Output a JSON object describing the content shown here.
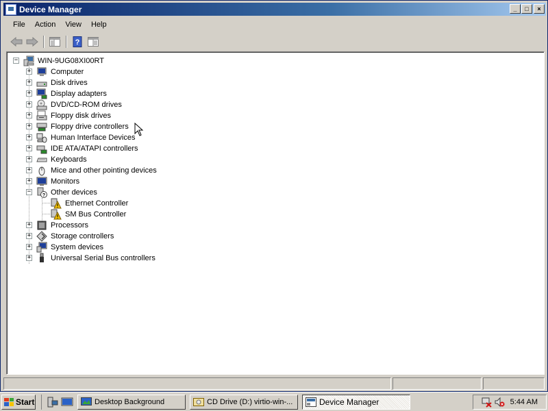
{
  "window": {
    "title": "Device Manager",
    "buttons": {
      "minimize": "_",
      "maximize": "□",
      "close": "×"
    }
  },
  "menu": [
    "File",
    "Action",
    "View",
    "Help"
  ],
  "toolbar": {
    "icons": [
      "back-arrow-icon",
      "forward-arrow-icon",
      "show-hide-console-tree-icon",
      "help-icon",
      "properties-icon"
    ]
  },
  "tree": {
    "root": {
      "label": "WIN-9UG08XI00RT",
      "icon": "computer-icon",
      "expanded": true
    },
    "categories": [
      {
        "label": "Computer",
        "icon": "computer-icon",
        "expanded": false
      },
      {
        "label": "Disk drives",
        "icon": "disk-drive-icon",
        "expanded": false
      },
      {
        "label": "Display adapters",
        "icon": "display-adapter-icon",
        "expanded": false
      },
      {
        "label": "DVD/CD-ROM drives",
        "icon": "dvd-drive-icon",
        "expanded": false
      },
      {
        "label": "Floppy disk drives",
        "icon": "floppy-drive-icon",
        "expanded": false
      },
      {
        "label": "Floppy drive controllers",
        "icon": "floppy-controller-icon",
        "expanded": false
      },
      {
        "label": "Human Interface Devices",
        "icon": "hid-icon",
        "expanded": false
      },
      {
        "label": "IDE ATA/ATAPI controllers",
        "icon": "ide-controller-icon",
        "expanded": false
      },
      {
        "label": "Keyboards",
        "icon": "keyboard-icon",
        "expanded": false
      },
      {
        "label": "Mice and other pointing devices",
        "icon": "mouse-icon",
        "expanded": false
      },
      {
        "label": "Monitors",
        "icon": "monitor-icon",
        "expanded": false
      },
      {
        "label": "Other devices",
        "icon": "unknown-device-icon",
        "expanded": true,
        "children": [
          {
            "label": "Ethernet Controller",
            "icon": "warning-device-icon"
          },
          {
            "label": "SM Bus Controller",
            "icon": "warning-device-icon"
          }
        ]
      },
      {
        "label": "Processors",
        "icon": "processor-icon",
        "expanded": false
      },
      {
        "label": "Storage controllers",
        "icon": "storage-controller-icon",
        "expanded": false
      },
      {
        "label": "System devices",
        "icon": "system-device-icon",
        "expanded": false
      },
      {
        "label": "Universal Serial Bus controllers",
        "icon": "usb-icon",
        "expanded": false
      }
    ]
  },
  "taskbar": {
    "start_label": "Start",
    "quick_launch": [
      "server-manager-icon",
      "show-desktop-icon"
    ],
    "tasks": [
      {
        "label": "Desktop Background",
        "icon": "desktop-background-icon",
        "active": false
      },
      {
        "label": "CD Drive (D:) virtio-win-...",
        "icon": "cd-drive-icon",
        "active": false
      },
      {
        "label": "Device Manager",
        "icon": "device-manager-icon",
        "active": true
      }
    ],
    "tray_icons": [
      "network-disconnected-icon",
      "volume-muted-icon"
    ],
    "clock": "5:44 AM"
  },
  "colors": {
    "title_bar": "#0a246a",
    "window_face": "#d4d0c8",
    "desktop": "#3a6ea5",
    "warning": "#f0c000"
  }
}
